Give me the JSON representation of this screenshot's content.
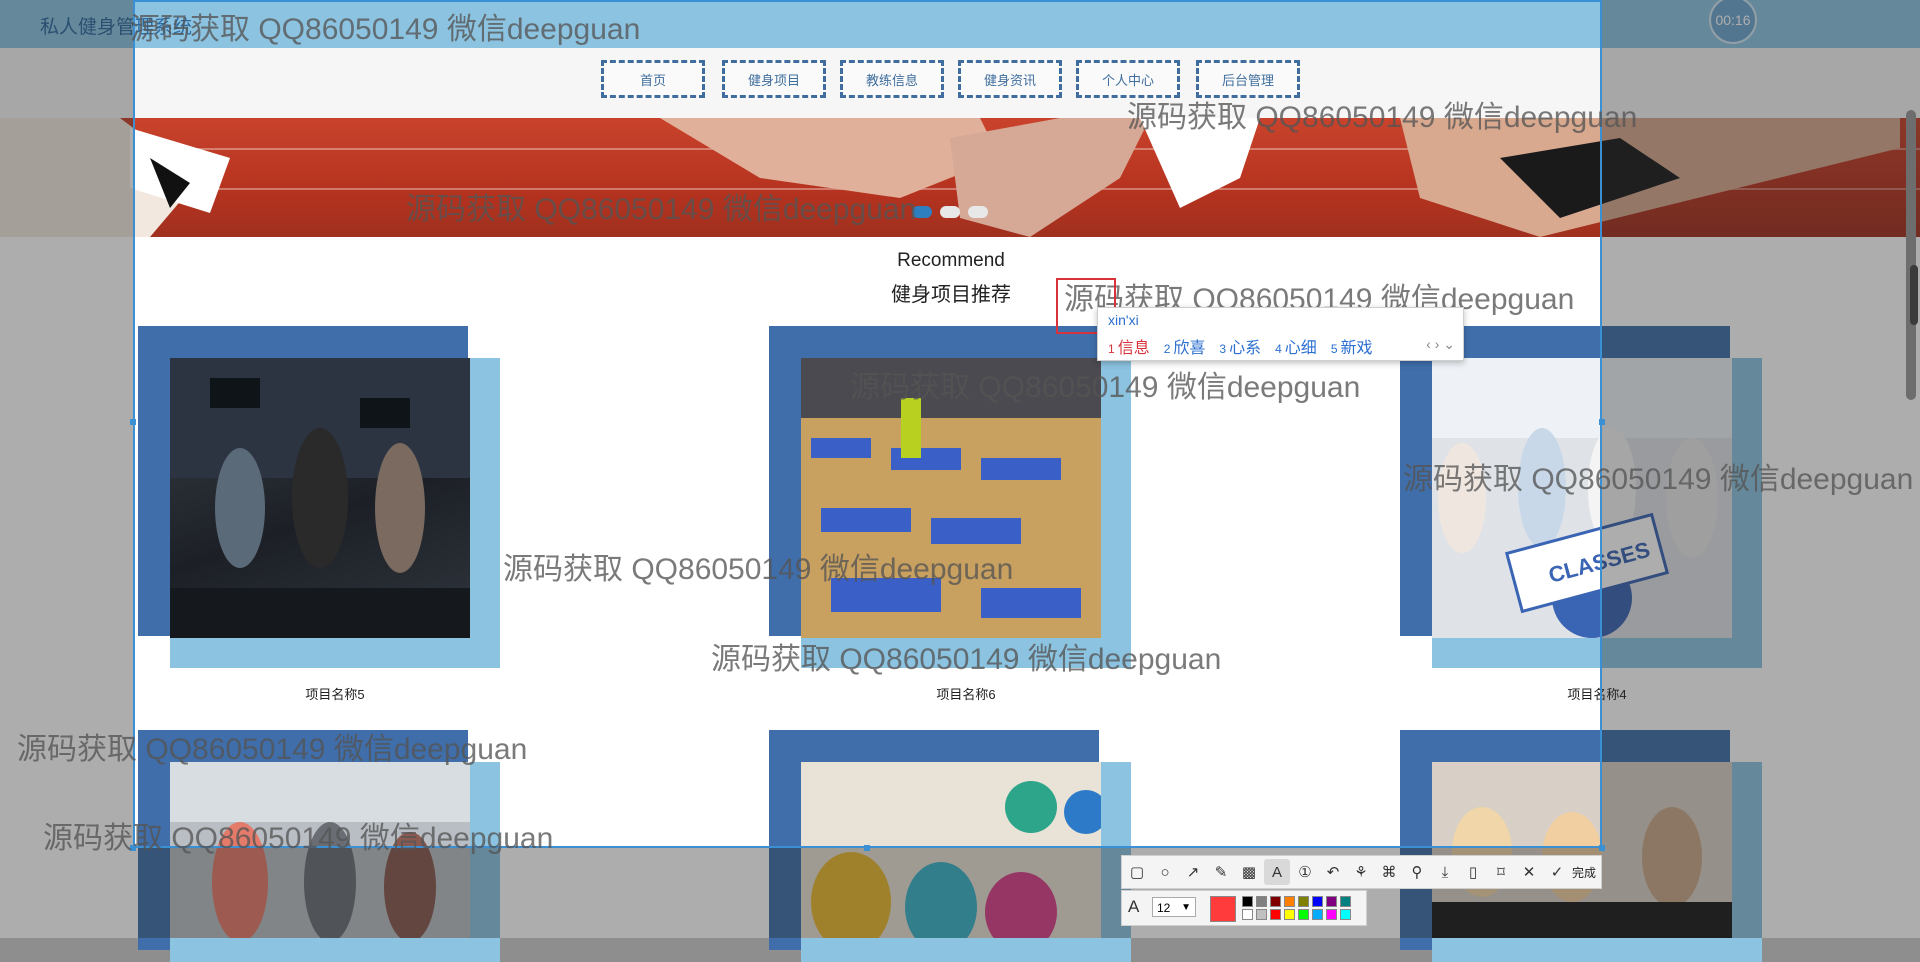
{
  "header": {
    "site_title": "私人健身管理系统",
    "timer": "00:16"
  },
  "nav": {
    "items": [
      "首页",
      "健身项目",
      "教练信息",
      "健身资讯",
      "个人中心",
      "后台管理"
    ]
  },
  "banner": {
    "dots": 3,
    "active_dot": 0
  },
  "section": {
    "title_en": "Recommend",
    "title_cn": "健身项目推荐"
  },
  "cards": [
    {
      "label": "项目名称5"
    },
    {
      "label": "项目名称6"
    },
    {
      "label": "项目名称4"
    },
    {
      "label": ""
    },
    {
      "label": ""
    },
    {
      "label": ""
    }
  ],
  "ime": {
    "input": "xin'xi",
    "candidates": [
      {
        "n": "1",
        "text": "信息"
      },
      {
        "n": "2",
        "text": "欣喜"
      },
      {
        "n": "3",
        "text": "心系"
      },
      {
        "n": "4",
        "text": "心细"
      },
      {
        "n": "5",
        "text": "新戏"
      }
    ]
  },
  "watermark": {
    "text": "源码获取 QQ86050149 微信deepguan"
  },
  "toolbar": {
    "icons": [
      "rect-icon",
      "ellipse-icon",
      "arrow-icon",
      "pen-icon",
      "mosaic-icon",
      "text-icon",
      "number-icon",
      "undo-icon",
      "pin-icon",
      "translate-icon",
      "ocr-icon",
      "download-icon",
      "save-icon",
      "bookmark-icon",
      "close-icon",
      "check-icon"
    ],
    "done_label": "完成",
    "font_size": "12",
    "font_glyph": "A",
    "current_color": "#ff3b3b",
    "palette": [
      "#000000",
      "#808080",
      "#800000",
      "#ff8000",
      "#808000",
      "#0000ff",
      "#800080",
      "#008080",
      "#ffffff",
      "#c0c0c0",
      "#ff0000",
      "#ffff00",
      "#00ff00",
      "#00aaff",
      "#ff00ff",
      "#00ffff"
    ]
  }
}
